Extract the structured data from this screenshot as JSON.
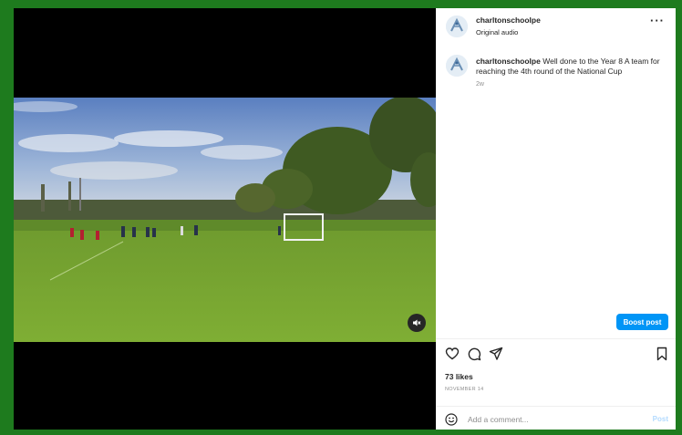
{
  "colors": {
    "frame": "#1e7b1e",
    "accent": "#0095f6",
    "text": "#262626",
    "muted": "#8e8e8e"
  },
  "header": {
    "username": "charltonschoolpe",
    "audio": "Original audio",
    "more_icon": "more-horizontal-icon"
  },
  "caption": {
    "username": "charltonschoolpe",
    "text": "Well done to the Year 8 A team for reaching the 4th round of the National Cup",
    "age": "2w"
  },
  "video": {
    "mute_icon": "volume-muted-icon"
  },
  "boost_label": "Boost post",
  "actions": {
    "icons": [
      "heart-icon",
      "comment-icon",
      "share-icon",
      "bookmark-icon"
    ],
    "likes": "73 likes",
    "date": "NOVEMBER 14"
  },
  "comment": {
    "placeholder": "Add a comment...",
    "post_label": "Post",
    "emoji_icon": "emoji-icon"
  }
}
